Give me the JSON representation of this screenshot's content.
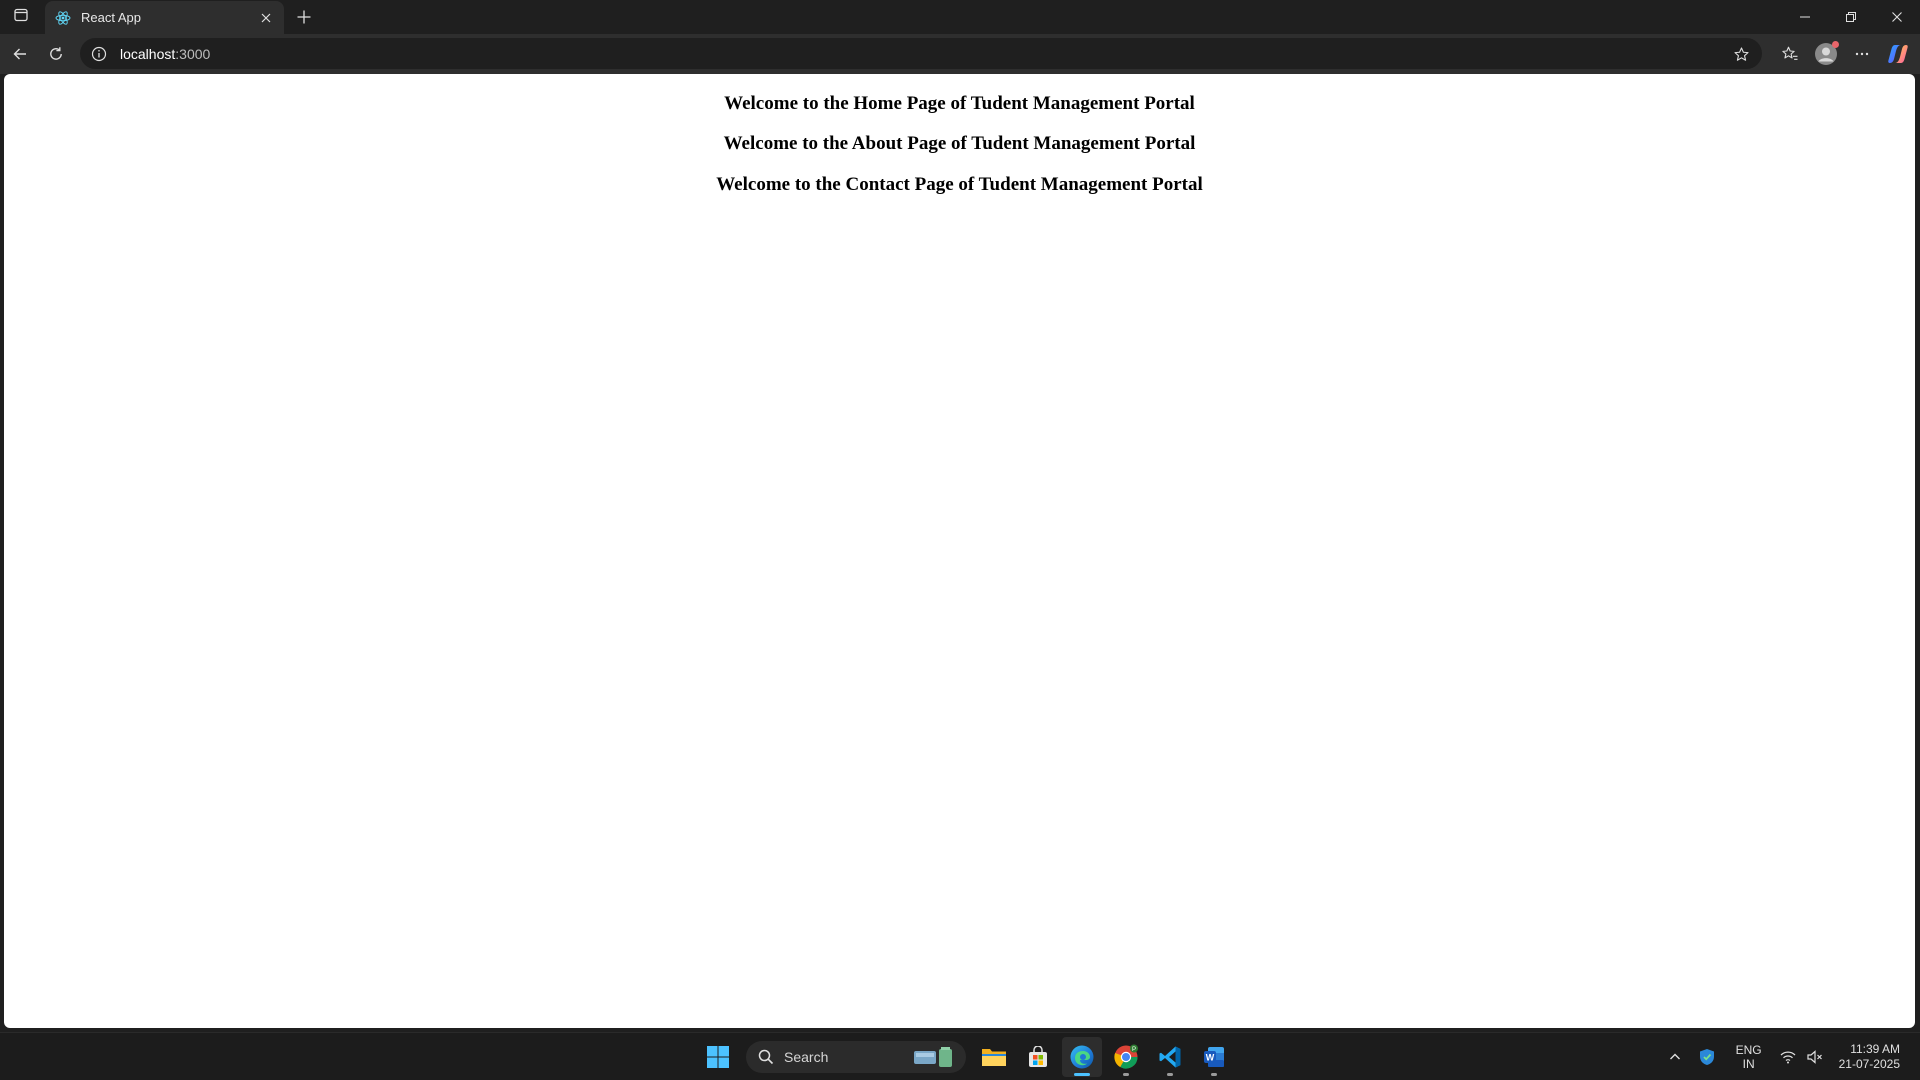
{
  "browser": {
    "tab": {
      "title": "React App"
    },
    "address": {
      "host": "localhost",
      "port": ":3000"
    }
  },
  "page": {
    "headings": [
      "Welcome to the Home Page of Tudent Management Portal",
      "Welcome to the About Page of Tudent Management Portal",
      "Welcome to the Contact Page of Tudent Management Portal"
    ]
  },
  "taskbar": {
    "search_label": "Search",
    "apps": [
      "windows-start",
      "file-explorer",
      "microsoft-store",
      "edge",
      "chrome",
      "vscode",
      "word"
    ],
    "language": {
      "line1": "ENG",
      "line2": "IN"
    },
    "clock": {
      "time": "11:39 AM",
      "date": "21-07-2025"
    }
  },
  "colors": {
    "accent": "#4cc2ff",
    "chrome_dark": "#1f1f1f",
    "toolbar": "#2e2e2e",
    "page_bg": "#ffffff"
  },
  "icons": [
    "tab-actions-icon",
    "react-favicon-icon",
    "close-icon",
    "plus-icon",
    "minimize-icon",
    "restore-icon",
    "window-close-icon",
    "back-icon",
    "refresh-icon",
    "info-icon",
    "star-icon",
    "favorites-icon",
    "profile-icon",
    "more-icon",
    "copilot-icon",
    "search-icon",
    "chevron-up-icon",
    "defender-icon",
    "wifi-icon",
    "volume-muted-icon"
  ]
}
